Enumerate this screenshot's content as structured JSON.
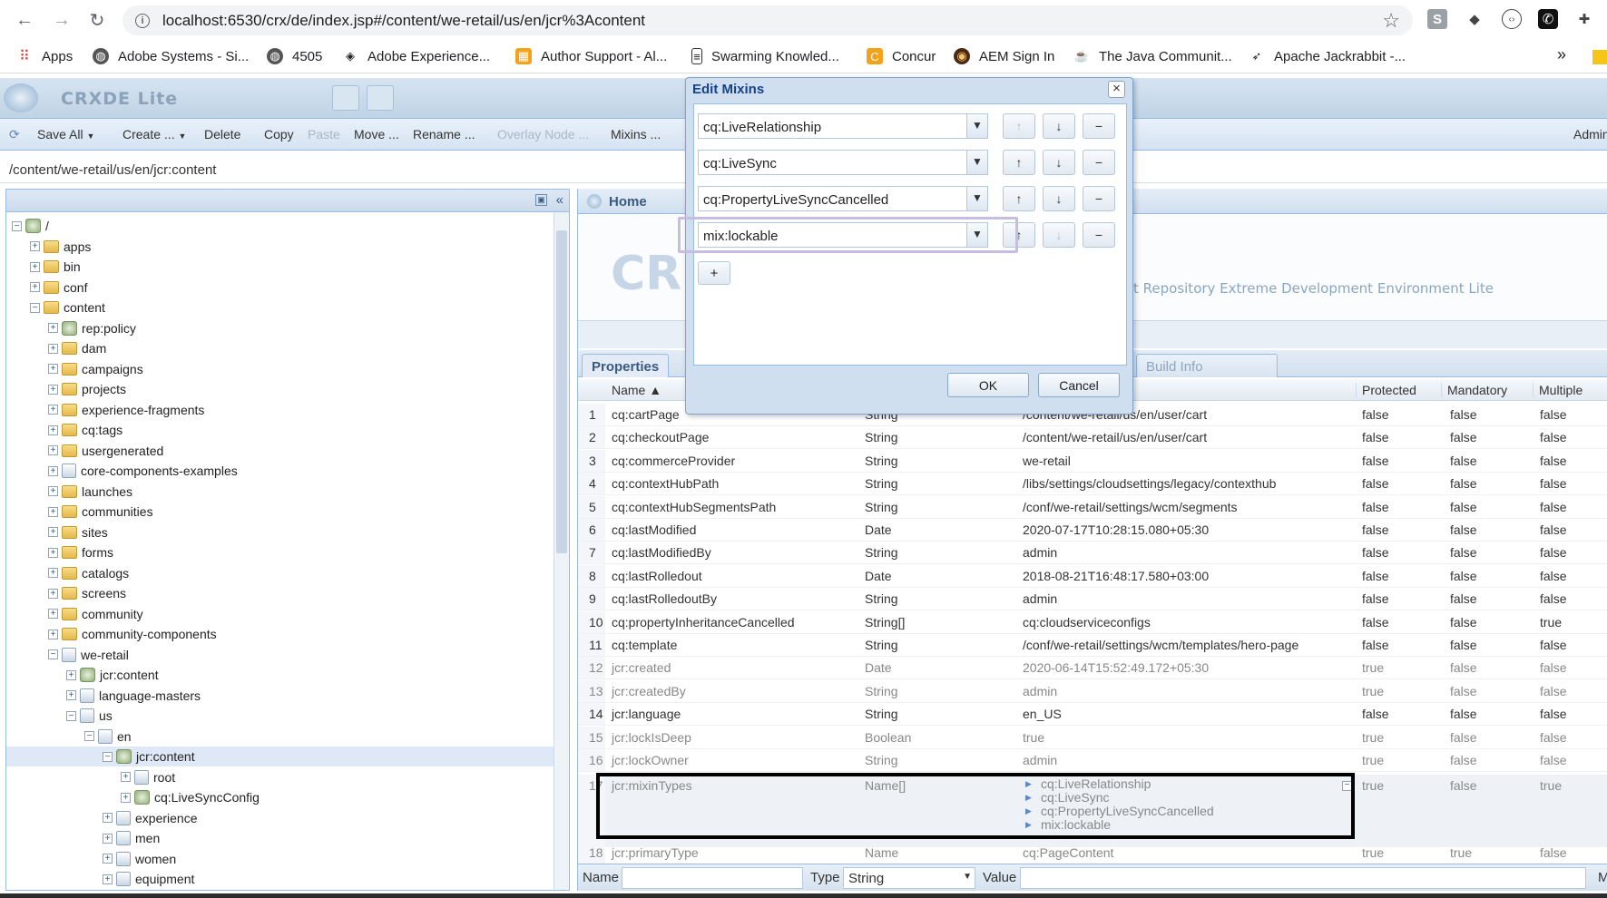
{
  "browser": {
    "url": "localhost:6530/crx/de/index.jsp#/content/we-retail/us/en/jcr%3Acontent",
    "bookmarks": [
      "Apps",
      "Adobe Systems - Si...",
      "4505",
      "Adobe Experience...",
      "Author Support - Al...",
      "Swarming Knowled...",
      "Concur",
      "AEM Sign In",
      "The Java Communit...",
      "Apache Jackrabbit -..."
    ],
    "more": "»"
  },
  "app": {
    "title": "CRXDE Lite",
    "toolbar": {
      "save_all": "Save All",
      "create": "Create ...",
      "delete": "Delete",
      "copy": "Copy",
      "paste": "Paste",
      "move": "Move ...",
      "rename": "Rename ...",
      "overlay": "Overlay Node ...",
      "mixins": "Mixins ...",
      "admin": "Admin"
    },
    "path": "/content/we-retail/us/en/jcr:content"
  },
  "tree": [
    {
      "label": "/",
      "exp": "−",
      "icon": "root"
    },
    {
      "label": "apps",
      "exp": "+",
      "icon": "folder"
    },
    {
      "label": "bin",
      "exp": "+",
      "icon": "folder"
    },
    {
      "label": "conf",
      "exp": "+",
      "icon": "folder"
    },
    {
      "label": "content",
      "exp": "−",
      "icon": "folder"
    },
    {
      "label": "rep:policy",
      "exp": "+",
      "icon": "node"
    },
    {
      "label": "dam",
      "exp": "+",
      "icon": "folder"
    },
    {
      "label": "campaigns",
      "exp": "+",
      "icon": "folder"
    },
    {
      "label": "projects",
      "exp": "+",
      "icon": "folder"
    },
    {
      "label": "experience-fragments",
      "exp": "+",
      "icon": "folder"
    },
    {
      "label": "cq:tags",
      "exp": "+",
      "icon": "folder"
    },
    {
      "label": "usergenerated",
      "exp": "+",
      "icon": "folder"
    },
    {
      "label": "core-components-examples",
      "exp": "+",
      "icon": "page"
    },
    {
      "label": "launches",
      "exp": "+",
      "icon": "folder"
    },
    {
      "label": "communities",
      "exp": "+",
      "icon": "folder"
    },
    {
      "label": "sites",
      "exp": "+",
      "icon": "folder"
    },
    {
      "label": "forms",
      "exp": "+",
      "icon": "folder"
    },
    {
      "label": "catalogs",
      "exp": "+",
      "icon": "folder"
    },
    {
      "label": "screens",
      "exp": "+",
      "icon": "folder"
    },
    {
      "label": "community",
      "exp": "+",
      "icon": "folder"
    },
    {
      "label": "community-components",
      "exp": "+",
      "icon": "folder"
    },
    {
      "label": "we-retail",
      "exp": "−",
      "icon": "page"
    },
    {
      "label": "jcr:content",
      "exp": "+",
      "icon": "node"
    },
    {
      "label": "language-masters",
      "exp": "+",
      "icon": "page"
    },
    {
      "label": "us",
      "exp": "−",
      "icon": "page"
    },
    {
      "label": "en",
      "exp": "−",
      "icon": "page"
    },
    {
      "label": "jcr:content",
      "exp": "−",
      "icon": "node"
    },
    {
      "label": "root",
      "exp": "+",
      "icon": "page"
    },
    {
      "label": "cq:LiveSyncConfig",
      "exp": "+",
      "icon": "node"
    },
    {
      "label": "experience",
      "exp": "+",
      "icon": "page"
    },
    {
      "label": "men",
      "exp": "+",
      "icon": "page"
    },
    {
      "label": "women",
      "exp": "+",
      "icon": "page"
    },
    {
      "label": "equipment",
      "exp": "+",
      "icon": "page"
    }
  ],
  "home": {
    "tab": "Home",
    "watermark": "CR",
    "tagline": "t Repository Extreme Development Environment Lite"
  },
  "properties": {
    "tabs": [
      "Properties",
      "Build Info"
    ],
    "columns": {
      "name": "Name ▲",
      "protected": "Protected",
      "mandatory": "Mandatory",
      "multiple": "Multiple"
    },
    "rows": [
      {
        "n": "1",
        "name": "cq:cartPage",
        "type": "String",
        "value": "/content/we-retail/us/en/user/cart",
        "p": "false",
        "m": "false",
        "mu": "false"
      },
      {
        "n": "2",
        "name": "cq:checkoutPage",
        "type": "String",
        "value": "/content/we-retail/us/en/user/cart",
        "p": "false",
        "m": "false",
        "mu": "false"
      },
      {
        "n": "3",
        "name": "cq:commerceProvider",
        "type": "String",
        "value": "we-retail",
        "p": "false",
        "m": "false",
        "mu": "false"
      },
      {
        "n": "4",
        "name": "cq:contextHubPath",
        "type": "String",
        "value": "/libs/settings/cloudsettings/legacy/contexthub",
        "p": "false",
        "m": "false",
        "mu": "false"
      },
      {
        "n": "5",
        "name": "cq:contextHubSegmentsPath",
        "type": "String",
        "value": "/conf/we-retail/settings/wcm/segments",
        "p": "false",
        "m": "false",
        "mu": "false"
      },
      {
        "n": "6",
        "name": "cq:lastModified",
        "type": "Date",
        "value": "2020-07-17T10:28:15.080+05:30",
        "p": "false",
        "m": "false",
        "mu": "false"
      },
      {
        "n": "7",
        "name": "cq:lastModifiedBy",
        "type": "String",
        "value": "admin",
        "p": "false",
        "m": "false",
        "mu": "false"
      },
      {
        "n": "8",
        "name": "cq:lastRolledout",
        "type": "Date",
        "value": "2018-08-21T16:48:17.580+03:00",
        "p": "false",
        "m": "false",
        "mu": "false"
      },
      {
        "n": "9",
        "name": "cq:lastRolledoutBy",
        "type": "String",
        "value": "admin",
        "p": "false",
        "m": "false",
        "mu": "false"
      },
      {
        "n": "10",
        "name": "cq:propertyInheritanceCancelled",
        "type": "String[]",
        "value": "cq:cloudserviceconfigs",
        "p": "false",
        "m": "false",
        "mu": "true"
      },
      {
        "n": "11",
        "name": "cq:template",
        "type": "String",
        "value": "/conf/we-retail/settings/wcm/templates/hero-page",
        "p": "false",
        "m": "false",
        "mu": "false"
      },
      {
        "n": "12",
        "name": "jcr:created",
        "type": "Date",
        "value": "2020-06-14T15:52:49.172+05:30",
        "p": "true",
        "m": "false",
        "mu": "false"
      },
      {
        "n": "13",
        "name": "jcr:createdBy",
        "type": "String",
        "value": "admin",
        "p": "true",
        "m": "false",
        "mu": "false"
      },
      {
        "n": "14",
        "name": "jcr:language",
        "type": "String",
        "value": "en_US",
        "p": "false",
        "m": "false",
        "mu": "false"
      },
      {
        "n": "15",
        "name": "jcr:lockIsDeep",
        "type": "Boolean",
        "value": "true",
        "p": "true",
        "m": "false",
        "mu": "false"
      },
      {
        "n": "16",
        "name": "jcr:lockOwner",
        "type": "String",
        "value": "admin",
        "p": "true",
        "m": "false",
        "mu": "false"
      }
    ],
    "mixin_row": {
      "n": "17",
      "name": "jcr:mixinTypes",
      "type": "Name[]",
      "values": [
        "cq:LiveRelationship",
        "cq:LiveSync",
        "cq:PropertyLiveSyncCancelled",
        "mix:lockable"
      ],
      "p": "true",
      "m": "false",
      "mu": "true"
    },
    "last_row": {
      "n": "18",
      "name": "jcr:primaryType",
      "type": "Name",
      "value": "cq:PageContent",
      "p": "true",
      "m": "true",
      "mu": "false"
    },
    "bottom": {
      "name_label": "Name",
      "type_label": "Type",
      "type_value": "String",
      "value_label": "Value",
      "m_label": "M"
    }
  },
  "dialog": {
    "title": "Edit Mixins",
    "mixins": [
      "cq:LiveRelationship",
      "cq:LiveSync",
      "cq:PropertyLiveSyncCancelled",
      "mix:lockable"
    ],
    "up": "↑",
    "down": "↓",
    "remove": "−",
    "add": "+",
    "ok": "OK",
    "cancel": "Cancel"
  }
}
